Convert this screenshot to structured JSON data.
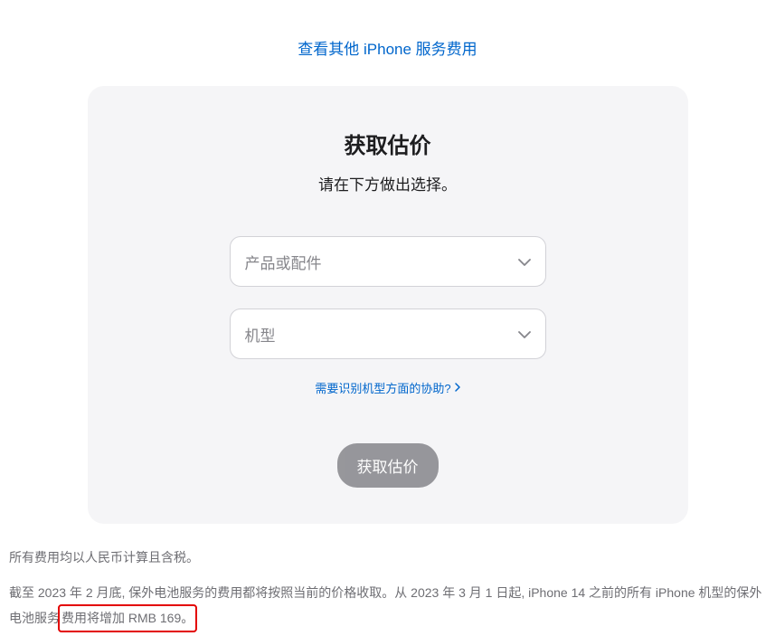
{
  "topLink": {
    "label": "查看其他 iPhone 服务费用"
  },
  "card": {
    "title": "获取估价",
    "subtitle": "请在下方做出选择。",
    "productSelect": {
      "placeholder": "产品或配件"
    },
    "modelSelect": {
      "placeholder": "机型"
    },
    "helpLink": {
      "label": "需要识别机型方面的协助?"
    },
    "submitButton": {
      "label": "获取估价"
    }
  },
  "footer": {
    "line1": "所有费用均以人民币计算且含税。",
    "line2_part1": "截至 2023 年 2 月底, 保外电池服务的费用都将按照当前的价格收取。从 2023 年 3 月 1 日起, iPhone 14 之前的所有 iPhone 机型的保外电池服务",
    "line2_highlighted": "费用将增加 RMB 169。"
  }
}
